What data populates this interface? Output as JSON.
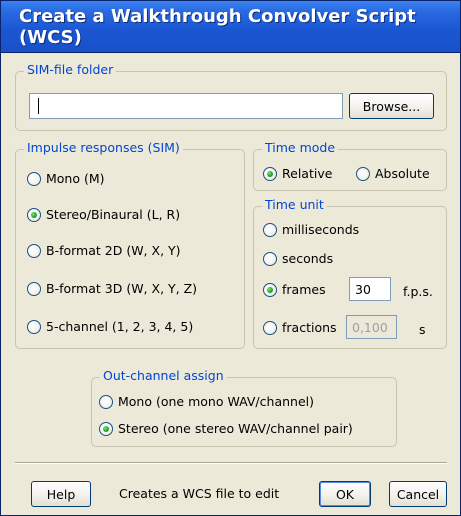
{
  "window": {
    "title": "Create a Walkthrough Convolver Script (WCS)"
  },
  "sim_folder": {
    "label": "SIM-file folder",
    "path_value": "",
    "browse_label": "Browse..."
  },
  "impulse": {
    "label": "Impulse responses (SIM)",
    "options": [
      {
        "label": "Mono (M)",
        "checked": false
      },
      {
        "label": "Stereo/Binaural (L, R)",
        "checked": true
      },
      {
        "label": "B-format 2D (W, X, Y)",
        "checked": false
      },
      {
        "label": "B-format 3D (W, X, Y, Z)",
        "checked": false
      },
      {
        "label": "5-channel (1, 2, 3, 4, 5)",
        "checked": false
      }
    ]
  },
  "time_mode": {
    "label": "Time mode",
    "relative_label": "Relative",
    "absolute_label": "Absolute",
    "selected": "Relative"
  },
  "time_unit": {
    "label": "Time unit",
    "milliseconds_label": "milliseconds",
    "seconds_label": "seconds",
    "frames_label": "frames",
    "frames_value": "30",
    "fps_label": "f.p.s.",
    "fractions_label": "fractions",
    "fractions_value": "0,100",
    "s_label": "s",
    "selected": "frames"
  },
  "out_channel": {
    "label": "Out-channel assign",
    "mono_label": "Mono (one mono WAV/channel)",
    "stereo_label": "Stereo (one stereo WAV/channel pair)",
    "selected": "Stereo"
  },
  "footer": {
    "help_label": "Help",
    "status_text": "Creates a WCS file to edit",
    "ok_label": "OK",
    "cancel_label": "Cancel"
  }
}
